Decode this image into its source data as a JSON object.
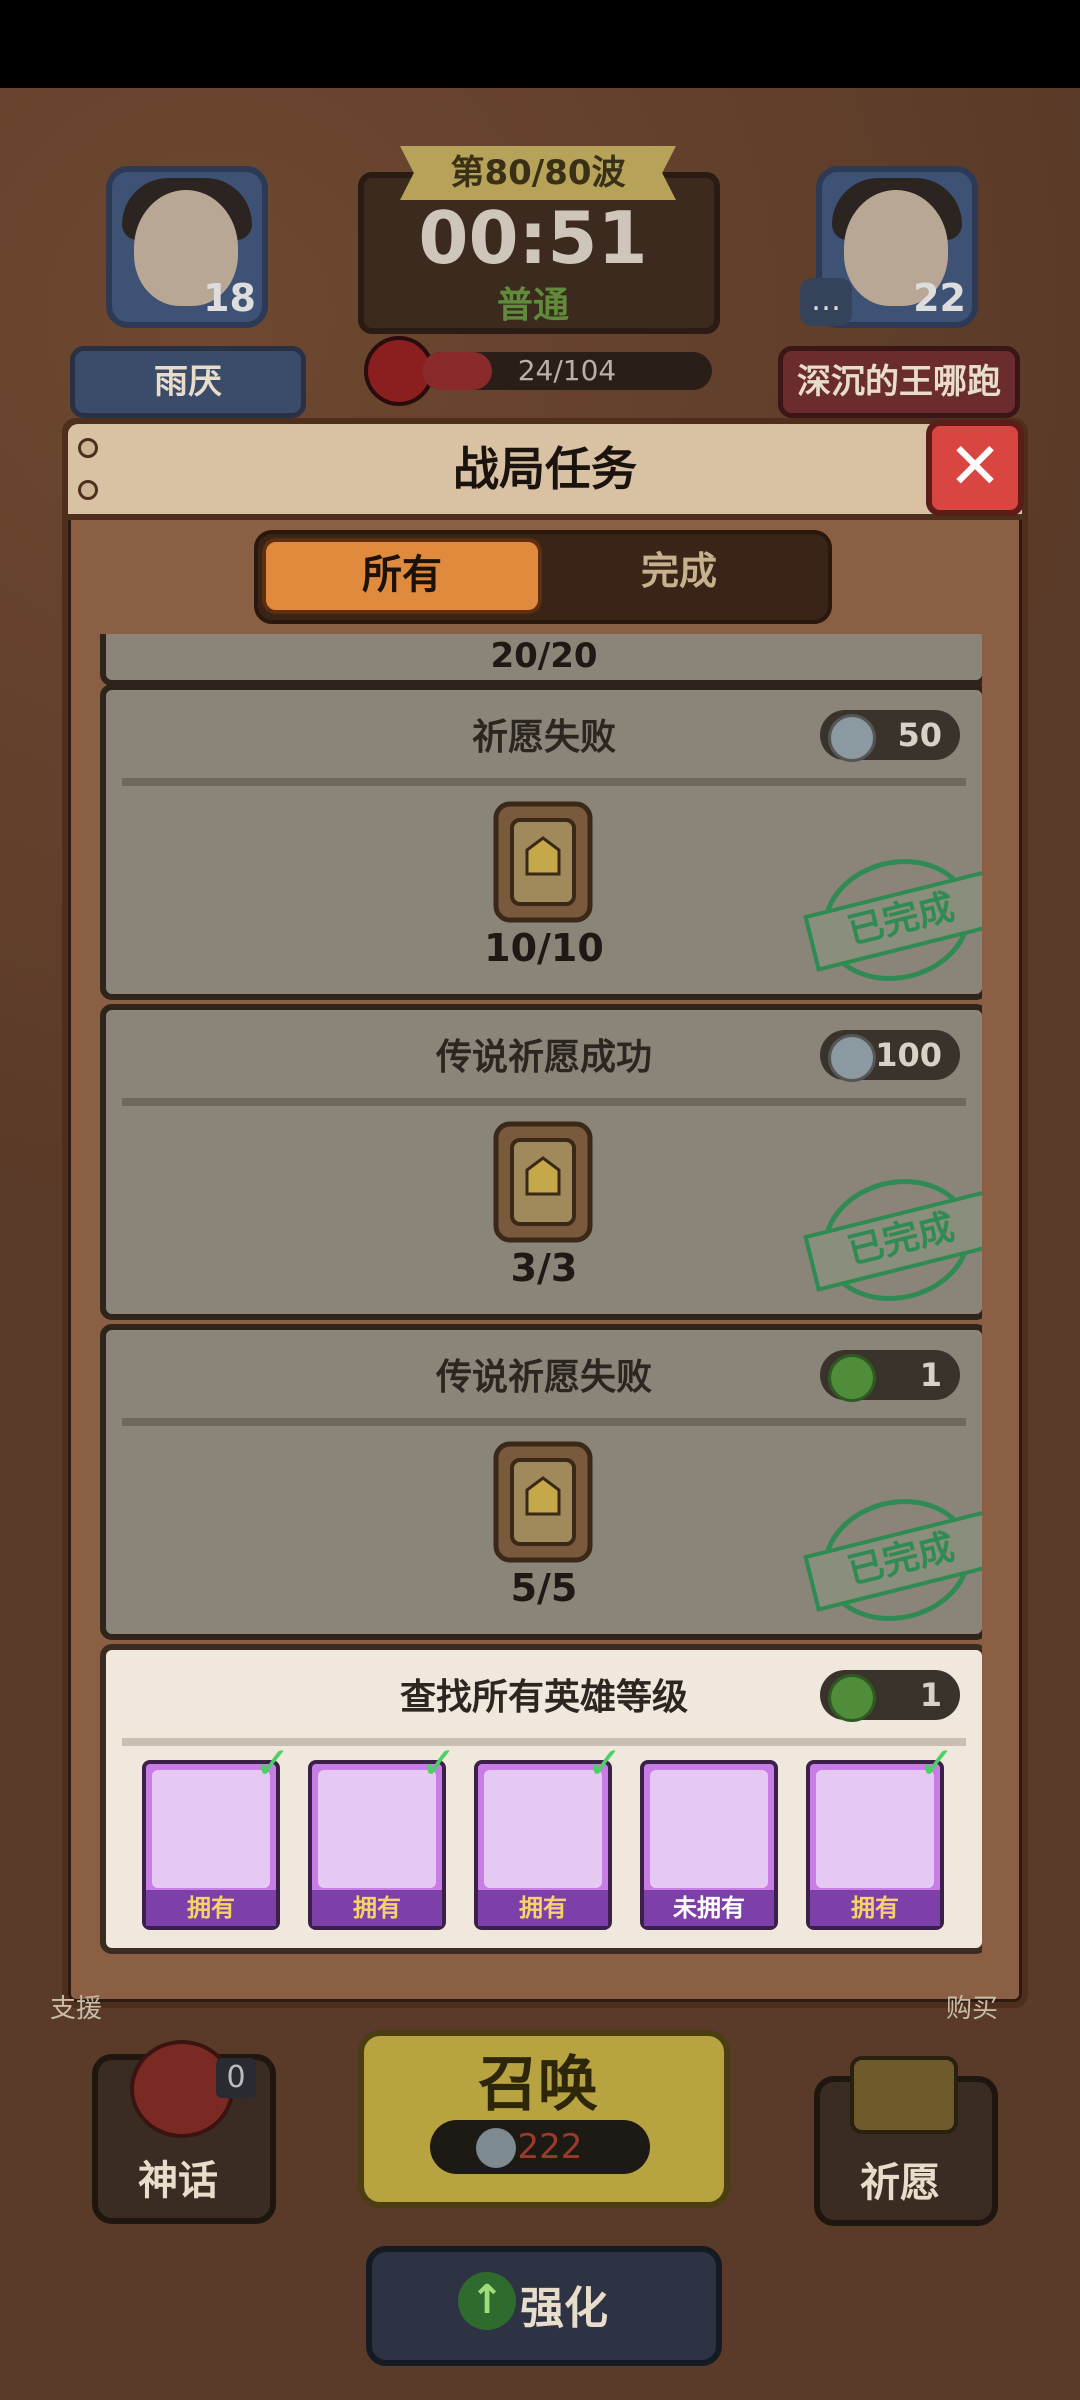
{
  "hud": {
    "wave": "第80/80波",
    "timer": "00:51",
    "difficulty": "普通",
    "boss_progress": "24/104",
    "player_left": {
      "name": "雨厌",
      "level": "18"
    },
    "player_right": {
      "name": "深沉的王哪跑",
      "level": "22"
    }
  },
  "modal": {
    "title": "战局任务",
    "close_label": "✕",
    "tabs": [
      {
        "label": "所有"
      },
      {
        "label": "完成"
      }
    ]
  },
  "tasks": [
    {
      "title": "祈愿失败",
      "reward": "50",
      "progress": "10/10",
      "stamp": "已完成"
    },
    {
      "title": "传说祈愿成功",
      "reward": "100",
      "progress": "3/3",
      "stamp": "已完成"
    },
    {
      "title": "传说祈愿失败",
      "reward": "1",
      "progress": "5/5",
      "stamp": "已完成"
    }
  ],
  "partial_task": {
    "progress": "20/20"
  },
  "hero_task": {
    "title": "查找所有英雄等级",
    "reward": "1",
    "heroes": [
      {
        "status": "拥有",
        "owned": true
      },
      {
        "status": "拥有",
        "owned": true
      },
      {
        "status": "拥有",
        "owned": true
      },
      {
        "status": "未拥有",
        "owned": false
      },
      {
        "status": "拥有",
        "owned": true
      }
    ]
  },
  "bottom": {
    "myth_label": "神话",
    "myth_count": "0",
    "summon_label": "召唤",
    "summon_cost": "222",
    "wish_label": "祈愿",
    "upgrade_label": "强化",
    "left_side_label": "支援",
    "right_side_label": "购买"
  },
  "colors": {
    "accent": "#e08a3e",
    "stamp": "#2f8b53",
    "close": "#d94641"
  }
}
